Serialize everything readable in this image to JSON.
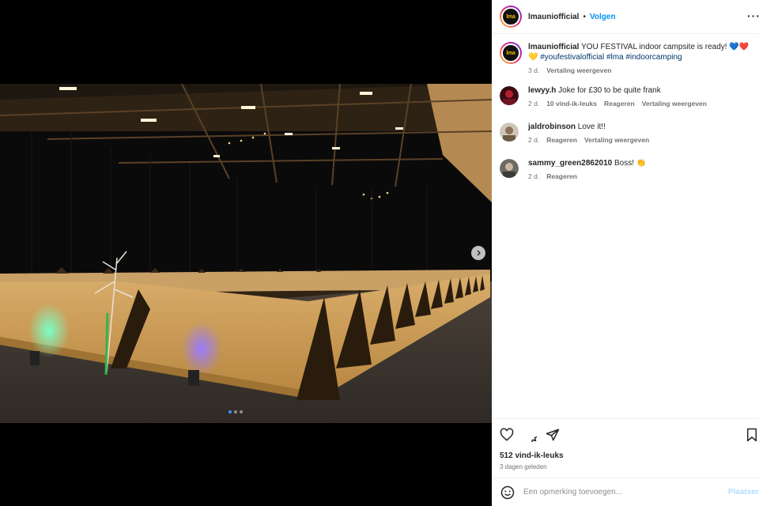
{
  "post": {
    "username": "lmauniofficial",
    "separator": "•",
    "follow_label": "Volgen",
    "avatar_text": "lma",
    "more_label": "···"
  },
  "caption": {
    "username": "lmauniofficial",
    "text": "YOU FESTIVAL indoor campsite is ready! 💙❤️💛",
    "hashtags": "#youfestivalofficial #lma #indoorcamping",
    "age": "3 d.",
    "translate": "Vertaling weergeven"
  },
  "comments": [
    {
      "username": "lewyy.h",
      "text": "Joke for £30 to be quite frank",
      "age": "2 d.",
      "likes": "10 vind-ik-leuks",
      "reply": "Reageren",
      "translate": "Vertaling weergeven"
    },
    {
      "username": "jaldrobinson",
      "text": "Love it!!",
      "age": "2 d.",
      "reply": "Reageren",
      "translate": "Vertaling weergeven"
    },
    {
      "username": "sammy_green2862010",
      "text": "Boss! 👏",
      "age": "2 d.",
      "reply": "Reageren"
    }
  ],
  "actions": {
    "likes": "512 vind-ik-leuks",
    "posted": "3 dagen geleden"
  },
  "composer": {
    "placeholder": "Een opmerking toevoegen...",
    "post_label": "Plaatsen"
  },
  "carousel": {
    "slides": 3,
    "active": 0
  },
  "icons": [
    "heart-icon",
    "comment-icon",
    "share-icon",
    "bookmark-icon",
    "emoji-icon",
    "chevron-right-icon"
  ]
}
